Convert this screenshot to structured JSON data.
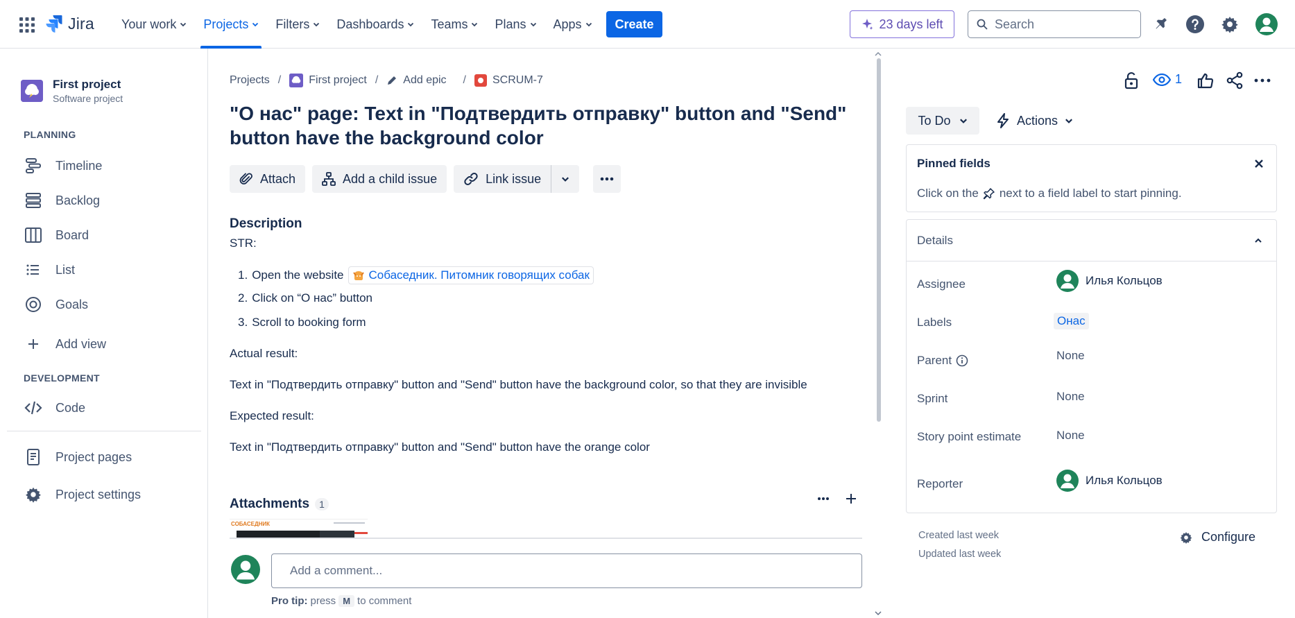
{
  "topnav": {
    "logo_text": "Jira",
    "items": [
      {
        "label": "Your work",
        "active": false
      },
      {
        "label": "Projects",
        "active": true
      },
      {
        "label": "Filters",
        "active": false
      },
      {
        "label": "Dashboards",
        "active": false
      },
      {
        "label": "Teams",
        "active": false
      },
      {
        "label": "Plans",
        "active": false
      },
      {
        "label": "Apps",
        "active": false
      }
    ],
    "create_label": "Create",
    "trial_label": "23 days left",
    "search_placeholder": "Search",
    "icons": [
      "apps-grid-icon",
      "notifications-icon",
      "help-icon",
      "settings-icon",
      "user-avatar"
    ]
  },
  "sidebar": {
    "project_name": "First project",
    "project_type": "Software project",
    "planning_heading": "PLANNING",
    "planning_items": [
      {
        "label": "Timeline",
        "icon": "timeline-icon"
      },
      {
        "label": "Backlog",
        "icon": "backlog-icon"
      },
      {
        "label": "Board",
        "icon": "board-icon"
      },
      {
        "label": "List",
        "icon": "list-icon"
      },
      {
        "label": "Goals",
        "icon": "goals-icon"
      },
      {
        "label": "Add view",
        "icon": "plus-icon"
      }
    ],
    "development_heading": "DEVELOPMENT",
    "development_items": [
      {
        "label": "Code",
        "icon": "code-icon"
      }
    ],
    "bottom_items": [
      {
        "label": "Project pages",
        "icon": "pages-icon"
      },
      {
        "label": "Project settings",
        "icon": "settings-icon"
      }
    ]
  },
  "breadcrumb": {
    "projects": "Projects",
    "project": "First project",
    "epic": "Add epic",
    "issue_key": "SCRUM-7"
  },
  "issue": {
    "title": "\"О нас\" page: Text in \"Подтвердить отправку\" button and \"Send\" button have the background color",
    "actions": {
      "attach": "Attach",
      "child": "Add a child issue",
      "link": "Link issue"
    },
    "description": {
      "heading": "Description",
      "str": "STR:",
      "steps": [
        {
          "text": "Open the website",
          "link": "Собаседник. Питомник говорящих собак"
        },
        {
          "text": "Click on “О нас” button"
        },
        {
          "text": "Scroll to booking form"
        }
      ],
      "actual_heading": "Actual result:",
      "actual_text": "Text in \"Подтвердить отправку\" button and \"Send\" button have the background color, so that they are invisible",
      "expected_heading": "Expected result:",
      "expected_text": "Text in \"Подтвердить отправку\" button and \"Send\" button have the orange color"
    },
    "attachments": {
      "heading": "Attachments",
      "count": "1",
      "thumb_brand": "СОБАСЕДНИК"
    },
    "comment": {
      "placeholder": "Add a comment...",
      "protip_prefix": "Pro tip:",
      "protip_press": "press",
      "protip_key": "M",
      "protip_suffix": "to comment"
    }
  },
  "right_panel": {
    "watch_count": "1",
    "status": "To Do",
    "actions": "Actions",
    "pinned": {
      "title": "Pinned fields",
      "desc_before": "Click on the",
      "desc_after": "next to a field label to start pinning."
    },
    "details": {
      "title": "Details",
      "rows": [
        {
          "label": "Assignee",
          "value": "Илья Кольцов"
        },
        {
          "label": "Labels",
          "value": "Онас"
        },
        {
          "label": "Parent",
          "value": "None"
        },
        {
          "label": "Sprint",
          "value": "None"
        },
        {
          "label": "Story point estimate",
          "value": "None"
        },
        {
          "label": "Reporter",
          "value": "Илья Кольцов"
        }
      ]
    },
    "created": "Created last week",
    "updated": "Updated last week",
    "configure": "Configure"
  },
  "colors": {
    "brand_blue": "#0c66e4",
    "text": "#172b4d",
    "subtle": "#44546f",
    "avatar_green": "#1f845a",
    "trial_purple": "#8270db"
  }
}
